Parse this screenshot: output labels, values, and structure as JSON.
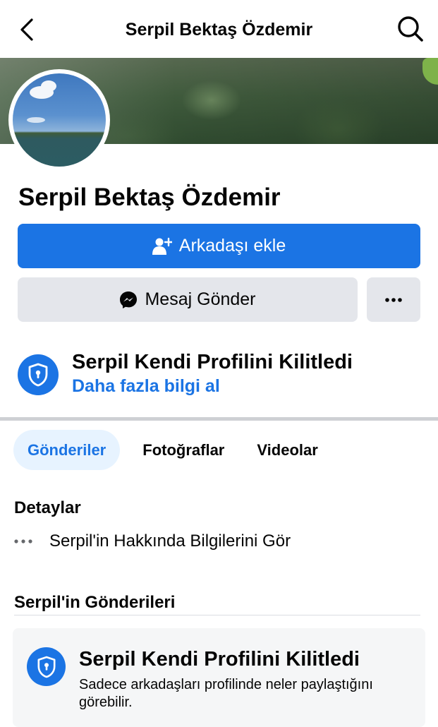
{
  "header": {
    "title": "Serpil Bektaş Özdemir"
  },
  "profile": {
    "name": "Serpil Bektaş Özdemir"
  },
  "actions": {
    "add_friend_label": "Arkadaşı ekle",
    "message_label": "Mesaj Gönder"
  },
  "lock_notice": {
    "title": "Serpil Kendi Profilini Kilitledi",
    "link": "Daha fazla bilgi al"
  },
  "tabs": [
    {
      "label": "Gönderiler",
      "active": true
    },
    {
      "label": "Fotoğraflar",
      "active": false
    },
    {
      "label": "Videolar",
      "active": false
    }
  ],
  "details": {
    "title": "Detaylar",
    "about_link": "Serpil'in Hakkında Bilgilerini Gör"
  },
  "posts": {
    "title": "Serpil'in Gönderileri",
    "locked_card": {
      "title": "Serpil Kendi Profilini Kilitledi",
      "description": "Sadece arkadaşları profilinde neler paylaştığını görebilir."
    }
  },
  "colors": {
    "primary": "#1b74e4",
    "secondary_button": "#e4e6eb",
    "active_tab_bg": "#e7f3ff"
  }
}
